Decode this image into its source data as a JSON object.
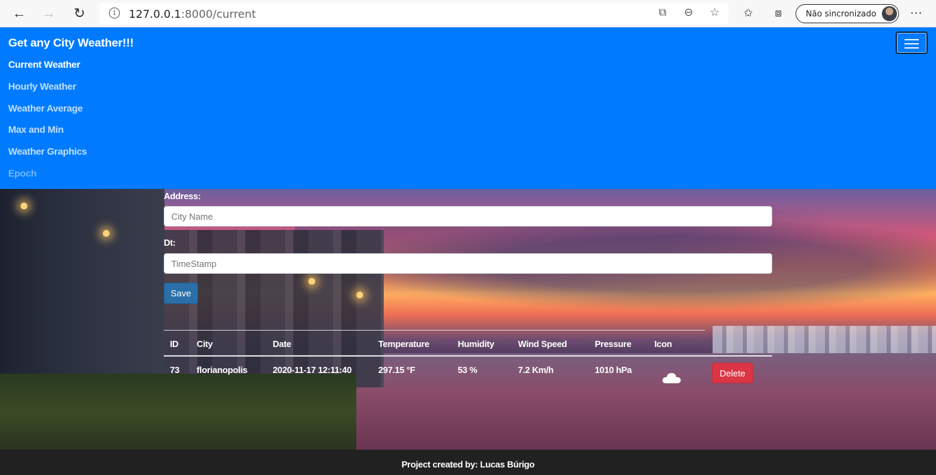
{
  "browser": {
    "url_host": "127.0.0.1",
    "url_path": ":8000/current",
    "sync_label": "Não sincronizado"
  },
  "navbar": {
    "brand": "Get any City Weather!!!",
    "links": [
      {
        "label": "Current Weather",
        "state": "active"
      },
      {
        "label": "Hourly Weather",
        "state": "normal"
      },
      {
        "label": "Weather Average",
        "state": "normal"
      },
      {
        "label": "Max and Min",
        "state": "normal"
      },
      {
        "label": "Weather Graphics",
        "state": "normal"
      },
      {
        "label": "Epoch",
        "state": "disabled"
      }
    ]
  },
  "form": {
    "address_label": "Address:",
    "city_placeholder": "City Name",
    "dt_label": "Dt:",
    "timestamp_placeholder": "TimeStamp",
    "save_label": "Save"
  },
  "table": {
    "headers": [
      "ID",
      "City",
      "Date",
      "Temperature",
      "Humidity",
      "Wind Speed",
      "Pressure",
      "Icon"
    ],
    "rows": [
      {
        "id": "73",
        "city": "florianopolis",
        "date": "2020-11-17 12:11:40",
        "temperature": "297.15 °F",
        "humidity": "53 %",
        "wind_speed": "7.2 Km/h",
        "pressure": "1010 hPa",
        "icon": "cloud-icon",
        "delete_label": "Delete"
      }
    ]
  },
  "footer": {
    "text": "Project created by: Lucas Búrigo"
  },
  "colors": {
    "navbar": "#007bff",
    "save_button": "#2a6fa8",
    "delete_button": "#dc3545",
    "footer": "#212121"
  }
}
